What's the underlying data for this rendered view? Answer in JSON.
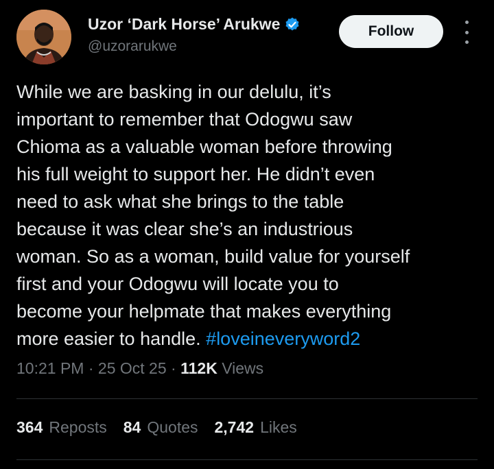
{
  "author": {
    "display_name": "Uzor ‘Dark Horse’ Arukwe",
    "handle": "@uzorarukwe",
    "verified_icon": "verified-badge-icon",
    "avatar_icon": "avatar"
  },
  "actions": {
    "follow_label": "Follow",
    "more_icon": "more-options-icon"
  },
  "tweet": {
    "text": "While we are basking in our delulu, it’s\nimportant to remember that Odogwu saw\nChioma as a valuable woman before throwing\nhis full weight to support her. He didn’t even\nneed to ask what she brings to the table\nbecause it was clear she’s an industrious\nwoman. So as a woman, build value for yourself\nfirst and your Odogwu will locate you to\nbecome your helpmate that makes everything\nmore easier to handle. ",
    "hashtag": "#loveineveryword2"
  },
  "meta": {
    "time": "10:21 PM",
    "sep1": " · ",
    "date": "25 Oct 25",
    "sep2": " · ",
    "views_count": "112K",
    "views_label": " Views"
  },
  "stats": {
    "reposts_count": "364",
    "reposts_label": "Reposts",
    "quotes_count": "84",
    "quotes_label": "Quotes",
    "likes_count": "2,742",
    "likes_label": "Likes"
  },
  "colors": {
    "background": "#000000",
    "text": "#e7e9ea",
    "muted": "#71767b",
    "accent": "#1d9bf0",
    "divider": "#2f3336"
  }
}
